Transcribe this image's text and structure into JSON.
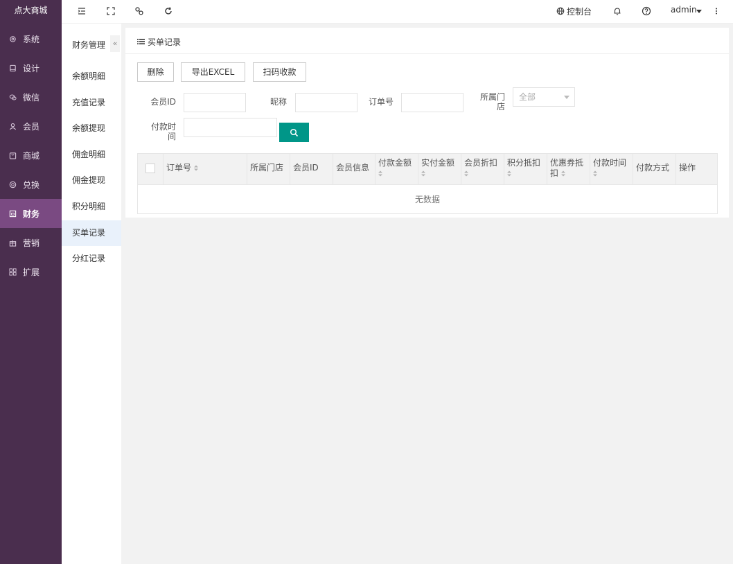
{
  "app": {
    "logo": "点大商城"
  },
  "sidebar": {
    "items": [
      {
        "label": "系统",
        "icon": "gear-icon"
      },
      {
        "label": "设计",
        "icon": "monitor-icon"
      },
      {
        "label": "微信",
        "icon": "wechat-icon"
      },
      {
        "label": "会员",
        "icon": "user-icon"
      },
      {
        "label": "商城",
        "icon": "bag-icon"
      },
      {
        "label": "兑换",
        "icon": "exchange-icon"
      },
      {
        "label": "财务",
        "icon": "finance-icon",
        "active": true
      },
      {
        "label": "营销",
        "icon": "gift-icon"
      },
      {
        "label": "扩展",
        "icon": "grid-icon"
      }
    ]
  },
  "subnav": {
    "title": "财务管理",
    "collapse": "«",
    "items": [
      {
        "label": "余额明细"
      },
      {
        "label": "充值记录"
      },
      {
        "label": "余额提现"
      },
      {
        "label": "佣金明细"
      },
      {
        "label": "佣金提现"
      },
      {
        "label": "积分明细"
      },
      {
        "label": "买单记录",
        "active": true
      },
      {
        "label": "分红记录"
      }
    ]
  },
  "topbar": {
    "console": "控制台",
    "user": "admin"
  },
  "panel": {
    "title": "买单记录",
    "buttons": {
      "delete": "删除",
      "export": "导出EXCEL",
      "scan": "扫码收款"
    },
    "filters": {
      "member_id": "会员ID",
      "nickname": "昵称",
      "order_no": "订单号",
      "store": "所属门店",
      "store_value": "全部",
      "pay_time": "付款时间"
    },
    "table": {
      "columns": [
        "订单号",
        "所属门店",
        "会员ID",
        "会员信息",
        "付款金额",
        "实付金额",
        "会员折扣",
        "积分抵扣",
        "优惠券抵扣",
        "付款时间",
        "付款方式",
        "操作"
      ],
      "empty": "无数据"
    }
  },
  "colors": {
    "sidebar_bg": "#4a2e4e",
    "sidebar_active": "#7a4a82",
    "search_btn": "#009688"
  }
}
